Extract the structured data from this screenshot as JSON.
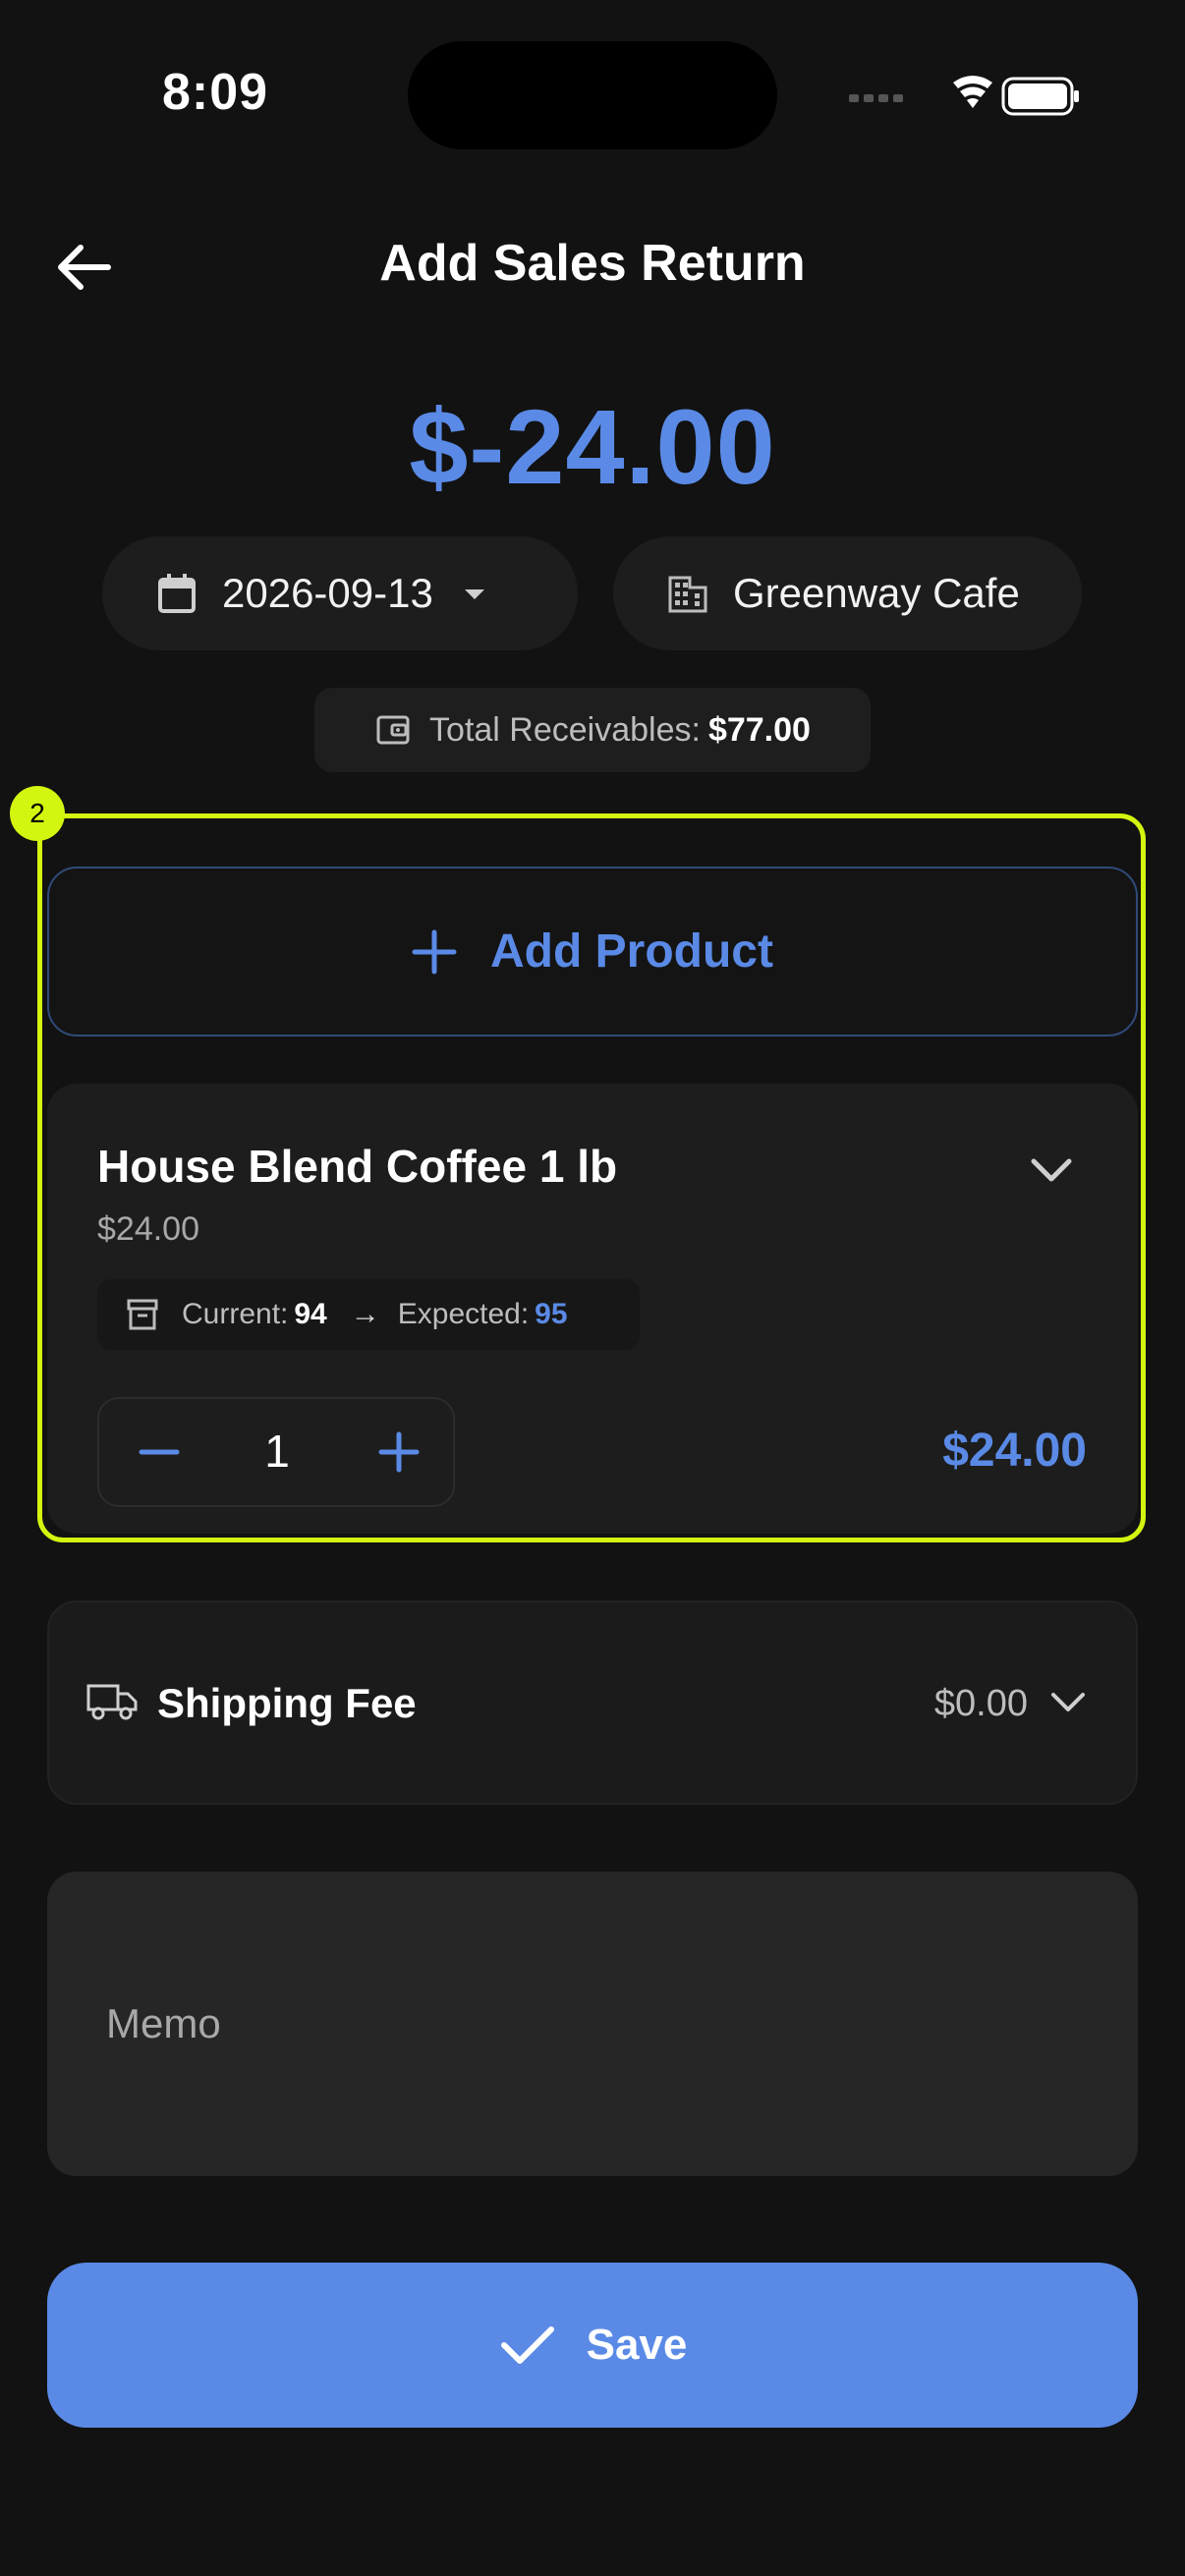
{
  "status": {
    "time": "8:09"
  },
  "header": {
    "title": "Add Sales Return",
    "back_icon": "arrow-left-icon"
  },
  "summary": {
    "amount": "$-24.00"
  },
  "filters": {
    "date": "2026-09-13",
    "customer": "Greenway Cafe"
  },
  "receivables": {
    "label": "Total Receivables:",
    "value": "$77.00"
  },
  "highlight": {
    "badge": "2"
  },
  "add_product": {
    "label": "Add Product"
  },
  "product": {
    "name": "House Blend Coffee 1 lb",
    "price": "$24.00",
    "current_label": "Current:",
    "current_value": "94",
    "arrow": "→",
    "expected_label": "Expected:",
    "expected_value": "95",
    "quantity": "1",
    "line_total": "$24.00"
  },
  "shipping": {
    "label": "Shipping Fee",
    "value": "$0.00"
  },
  "memo": {
    "placeholder": "Memo"
  },
  "save": {
    "label": "Save"
  },
  "colors": {
    "accent": "#5a8ae6",
    "highlight": "#d4f50f",
    "background": "#121212"
  }
}
